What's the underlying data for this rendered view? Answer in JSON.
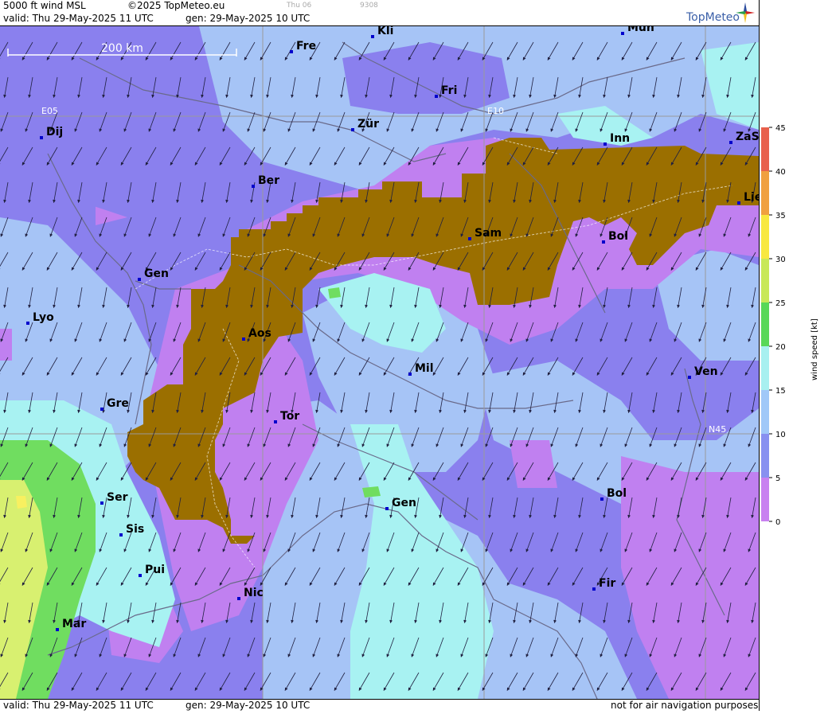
{
  "header": {
    "product": "5000 ft wind MSL",
    "copyright": "©2025 TopMeteo.eu",
    "valid": "valid:  Thu  29-May-2025  11 UTC",
    "generated": "gen: 29-May-2025 10 UTC",
    "faint_day": "Thu 06",
    "faint_code": "9308",
    "logo": "TopMeteo"
  },
  "footer": {
    "valid": "valid:  Thu  29-May-2025  11 UTC",
    "generated": "gen: 29-May-2025 10 UTC",
    "disclaimer": "not for air navigation purposes"
  },
  "scale_bar": {
    "label": "200 km"
  },
  "grid_labels": {
    "lon1": "E05",
    "lon2": "E10",
    "lat1": "N45"
  },
  "cities": [
    {
      "name": "Kli"
    },
    {
      "name": "Mün"
    },
    {
      "name": "Fre"
    },
    {
      "name": "Fri"
    },
    {
      "name": "Dij"
    },
    {
      "name": "Zür"
    },
    {
      "name": "Inn"
    },
    {
      "name": "ZaS"
    },
    {
      "name": "Ber"
    },
    {
      "name": "Lie"
    },
    {
      "name": "Sam"
    },
    {
      "name": "Bol"
    },
    {
      "name": "Gen"
    },
    {
      "name": "Lyo"
    },
    {
      "name": "Aos"
    },
    {
      "name": "Mil"
    },
    {
      "name": "Ven"
    },
    {
      "name": "Gre"
    },
    {
      "name": "Tor"
    },
    {
      "name": "Ser"
    },
    {
      "name": "Gen"
    },
    {
      "name": "Bol"
    },
    {
      "name": "Sis"
    },
    {
      "name": "Pui"
    },
    {
      "name": "Nic"
    },
    {
      "name": "Fir"
    },
    {
      "name": "Mar"
    }
  ],
  "legend": {
    "title": "wind speed [kt]",
    "ticks": [
      "45",
      "40",
      "35",
      "30",
      "25",
      "20",
      "15",
      "10",
      "5",
      "0"
    ],
    "colors": [
      "#e8604c",
      "#f0a040",
      "#f8e840",
      "#c8e858",
      "#58d858",
      "#a8f0f0",
      "#a0c8f8",
      "#8890f0",
      "#c880f0",
      "#e090f0"
    ]
  },
  "colors": {
    "terrain": "#9b6f00",
    "slow": "#c080f0",
    "medium_slow": "#8a80ee",
    "medium": "#a6c4f6",
    "fast": "#a8f2f2",
    "faster": "#70dd60",
    "fastest": "#f0f060"
  }
}
